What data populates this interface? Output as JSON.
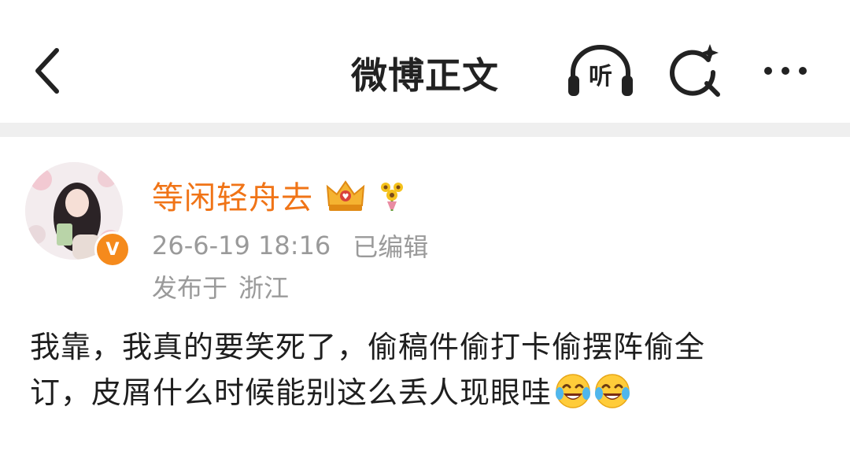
{
  "header": {
    "title": "微博正文",
    "listen_label": "听",
    "back_icon": "chevron-left-icon",
    "search_icon": "search-sparkle-icon",
    "more_icon": "more-horizontal-icon"
  },
  "post": {
    "author": {
      "name": "等闲轻舟去",
      "verified_mark": "V",
      "name_color": "#f07417",
      "badges": [
        "crown-badge-icon",
        "sunflower-badge-icon"
      ]
    },
    "timestamp": "26-6-19 18:16",
    "edited_label": "已编辑",
    "location_prefix": "发布于",
    "location": "浙江",
    "text": {
      "line1": "我靠，我真的要笑死了，偷稿件偷打卡偷摆阵偷全",
      "line2": "订，皮屑什么时候能别这么丢人现眼哇"
    },
    "emojis": [
      "laughing-tears-emoji",
      "laughing-tears-emoji"
    ]
  }
}
